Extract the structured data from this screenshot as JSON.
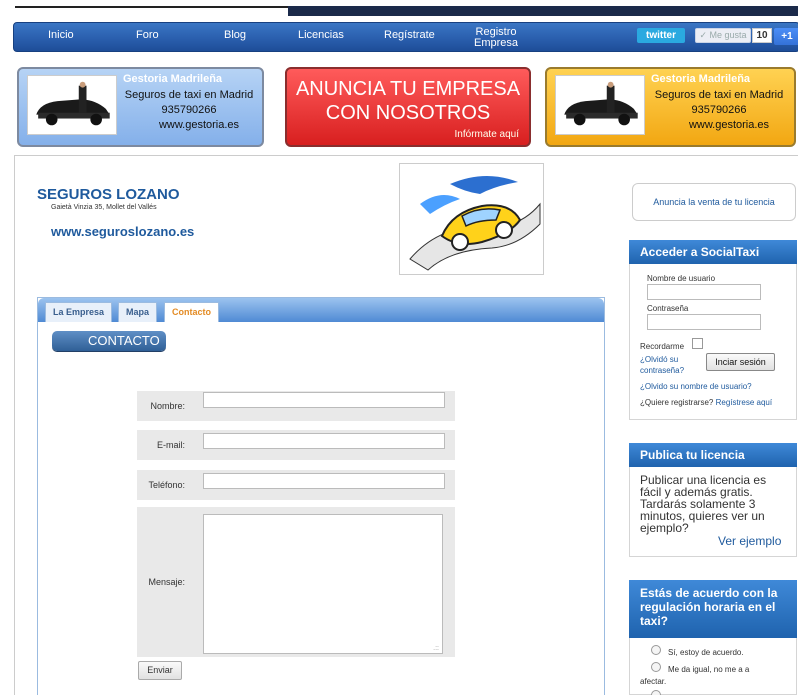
{
  "nav": {
    "items": [
      "Inicio",
      "Foro",
      "Blog",
      "Licencias",
      "Regístrate",
      "Registro",
      "Empresa"
    ],
    "twitter": "twitter",
    "like": "✓ Me gusta",
    "like_count": "10",
    "plus_one": "+1"
  },
  "banners": {
    "left": {
      "title": "Gestoria Madrileña",
      "line1": "Seguros de taxi en Madrid",
      "line2": "935790266",
      "line3": "www.gestoria.es"
    },
    "center": {
      "line1": "ANUNCIA TU EMPRESA",
      "line2": "CON NOSOTROS",
      "small": "Infórmate aquí"
    },
    "right": {
      "title": "Gestoria Madrileña",
      "line1": "Seguros de taxi en Madrid",
      "line2": "935790266",
      "line3": "www.gestoria.es"
    }
  },
  "company": {
    "name": "SEGUROS LOZANO",
    "address": "Gaietà Vinzia 35, Mollet del Vallés",
    "website": "www.seguroslozano.es"
  },
  "tabs": [
    {
      "label": "La Empresa"
    },
    {
      "label": "Mapa"
    },
    {
      "label": "Contacto"
    }
  ],
  "contact": {
    "heading": "CONTACTO",
    "name_label": "Nombre:",
    "email_label": "E-mail:",
    "phone_label": "Teléfono:",
    "message_label": "Mensaje:",
    "send": "Enviar"
  },
  "sidebar": {
    "announce": "Anuncia la venta de tu licencia",
    "login": {
      "title": "Acceder a SocialTaxi",
      "username_label": "Nombre de usuario",
      "password_label": "Contraseña",
      "remember_label": "Recordarme",
      "forgot_password_1": "¿Olvidó su",
      "forgot_password_2": "contraseña?",
      "forgot_username": "¿Olvido su nombre de usuario?",
      "register_q": "¿Quiere registrarse?",
      "register_link": "Regístrese aquí",
      "login_button": "Inciar sesión"
    },
    "publish": {
      "title": "Publica tu licencia",
      "text": "Publicar una licencia es fácil y además gratis. Tardarás solamente 3 minutos, quieres ver un ejemplo?",
      "link": "Ver ejemplo"
    },
    "poll": {
      "title_1": "Estás de acuerdo con la",
      "title_2": "regulación horaria en el",
      "title_3": "taxi?",
      "options": [
        "Sí, estoy de acuerdo.",
        "Me da igual, no me a a",
        "afectar."
      ]
    }
  }
}
